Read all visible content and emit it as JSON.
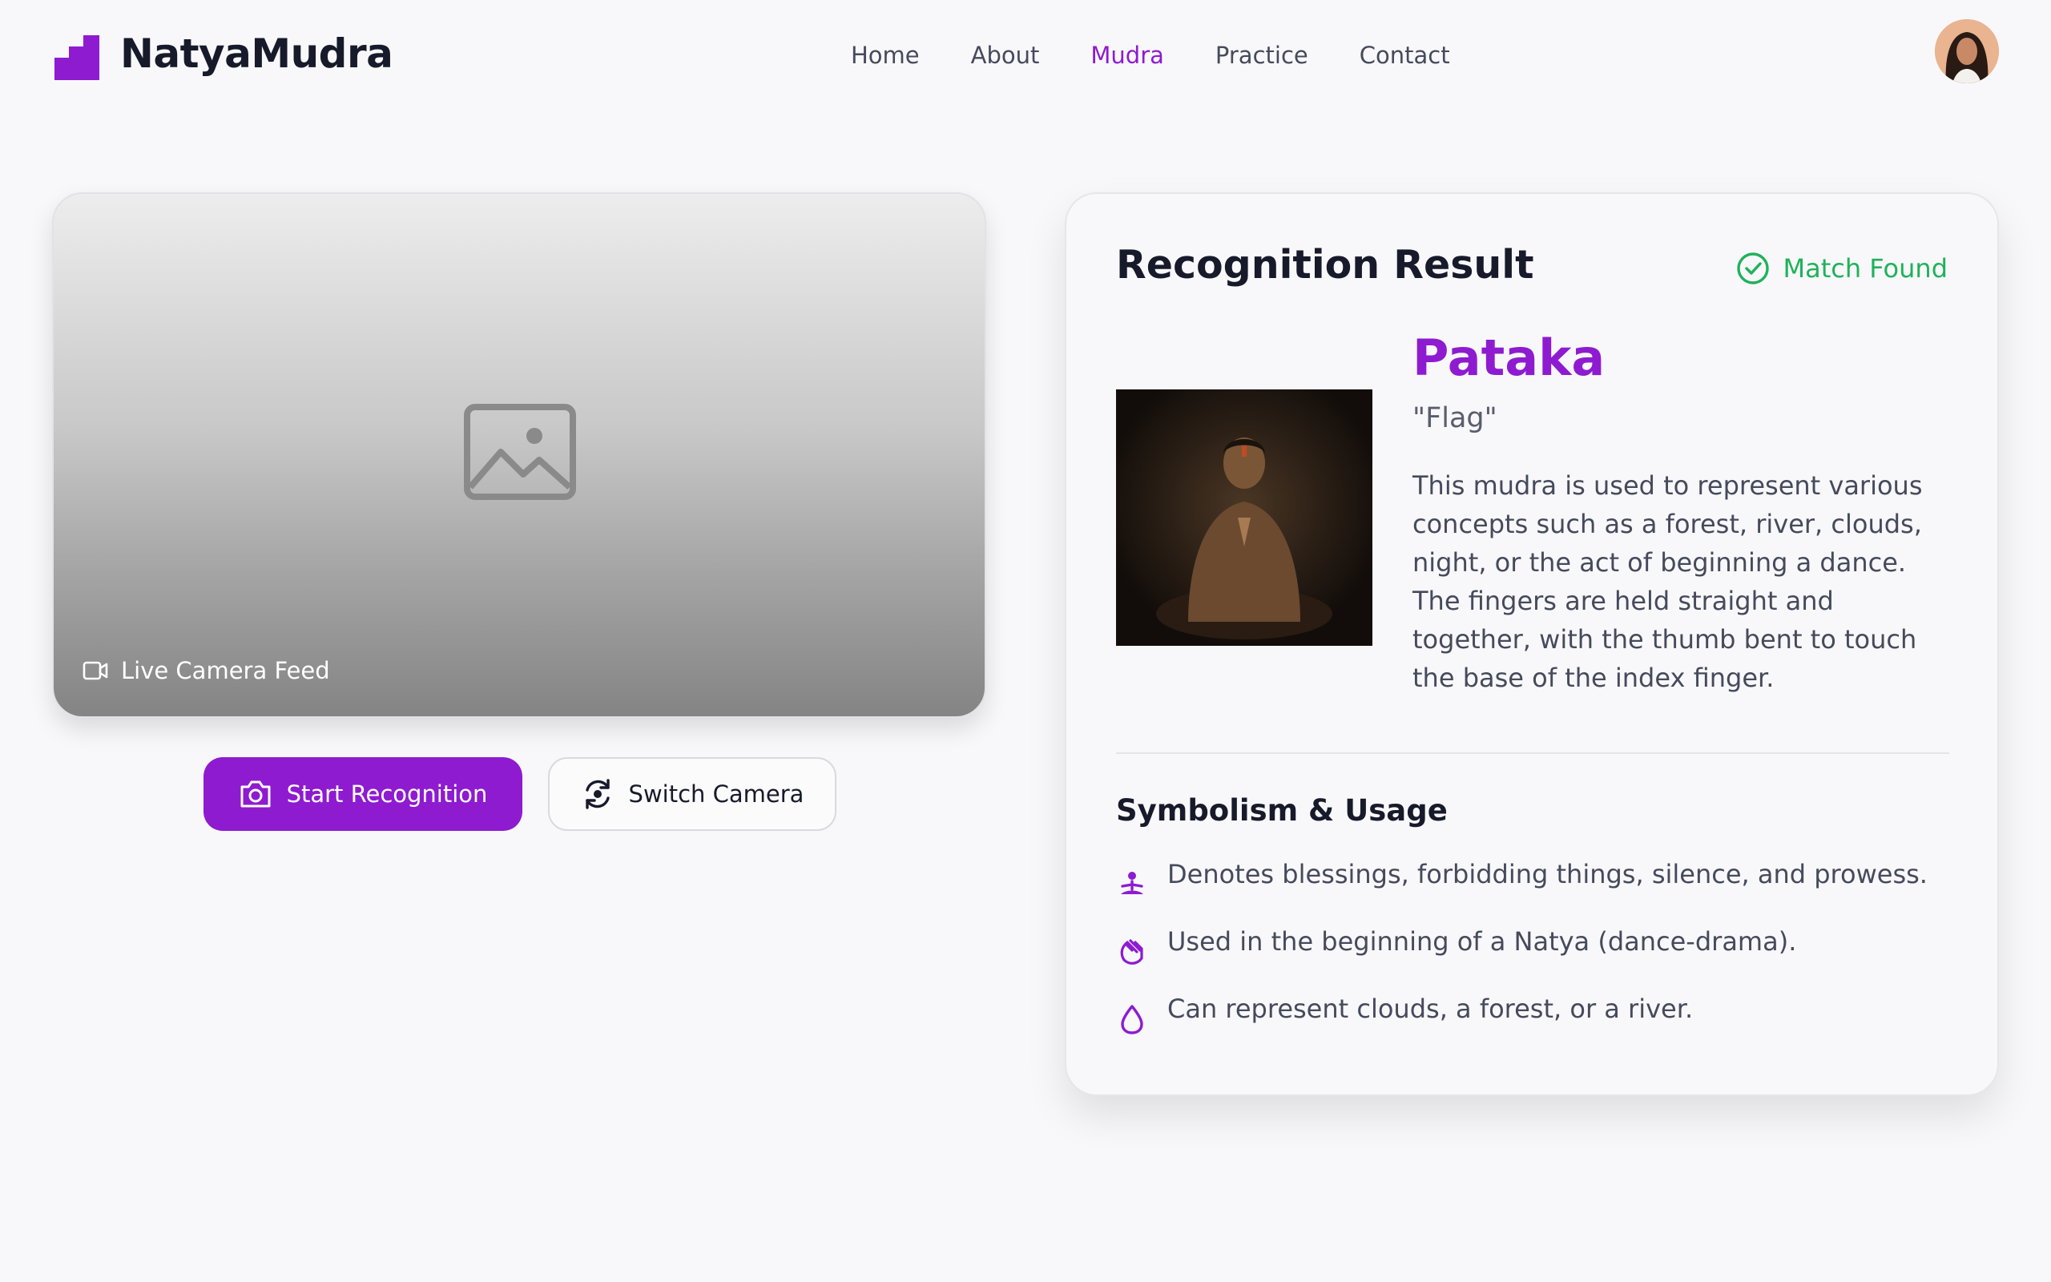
{
  "brand": {
    "name": "NatyaMudra",
    "accent": "#8e1bd0"
  },
  "nav": {
    "items": [
      {
        "label": "Home"
      },
      {
        "label": "About"
      },
      {
        "label": "Mudra"
      },
      {
        "label": "Practice"
      },
      {
        "label": "Contact"
      }
    ],
    "active": "Mudra"
  },
  "camera": {
    "feed_label": "Live Camera Feed",
    "icons": {
      "placeholder": "image-icon",
      "feed": "video-camera-icon"
    }
  },
  "actions": {
    "start_label": "Start Recognition",
    "switch_label": "Switch Camera",
    "icons": {
      "start": "camera-icon",
      "switch": "switch-camera-icon"
    }
  },
  "result": {
    "title": "Recognition Result",
    "status": "Match Found",
    "status_color": "#1fb25a",
    "mudra": {
      "name": "Pataka",
      "meaning": "\"Flag\"",
      "description": "This mudra is used to represent various concepts such as a forest, river, clouds, night, or the act of beginning a dance. The fingers are held straight and together, with the thumb bent to touch the base of the index finger."
    },
    "symbolism": {
      "title": "Symbolism & Usage",
      "items": [
        {
          "icon": "meditation-icon",
          "text": "Denotes blessings, forbidding things, silence, and prowess."
        },
        {
          "icon": "waving-hand-icon",
          "text": "Used in the beginning of a Natya (dance-drama)."
        },
        {
          "icon": "water-drop-icon",
          "text": "Can represent clouds, a forest, or a river."
        }
      ]
    }
  }
}
